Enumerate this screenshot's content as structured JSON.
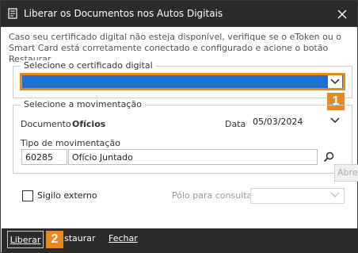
{
  "window": {
    "title": "Liberar os Documentos nos Autos Digitais"
  },
  "info_text": "Caso seu certificado digital não esteja disponível, verifique se o eToken ou o Smart Card está corretamente conectado e configurado e acione o botão Restaurar.",
  "certificate": {
    "legend": "Selecione o certificado digital",
    "selected_value": ""
  },
  "movement": {
    "legend": "Selecione a movimentação",
    "documento_label": "Documento",
    "documento_value": "Ofícios",
    "data_label": "Data",
    "data_value": "05/03/2024",
    "tipo_label": "Tipo de movimentação",
    "tipo_code": "60285",
    "tipo_desc": "Ofício Juntado"
  },
  "tooltip": "Abre",
  "sigilo": {
    "label": "Sigilo externo",
    "checked": false
  },
  "polo": {
    "label": "Pólo para consulta",
    "value": ""
  },
  "footer": {
    "liberar": "Liberar",
    "restaurar": "staurar",
    "fechar": "Fechar"
  },
  "annotations": {
    "badge_1": "1",
    "badge_2": "2"
  },
  "colors": {
    "titlebar_bg": "#2b2b2b",
    "accent_orange": "#e8891e",
    "selection_blue": "#1e6fd6"
  }
}
